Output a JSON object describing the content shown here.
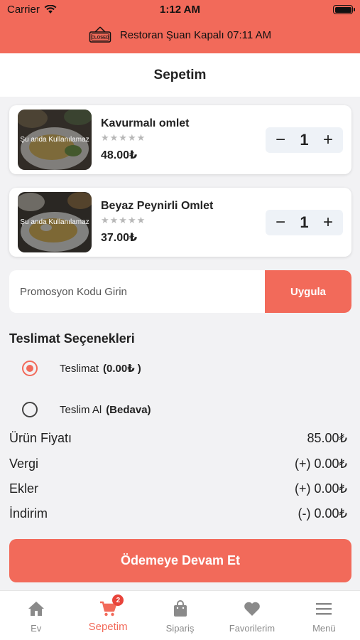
{
  "status_bar": {
    "carrier": "Carrier",
    "time": "1:12 AM"
  },
  "banner": {
    "sign_text": "CLOSED",
    "text": "Restoran Şuan Kapalı 07:11 AM"
  },
  "header": {
    "title": "Sepetim"
  },
  "cart": {
    "items": [
      {
        "name": "Kavurmalı omlet",
        "unavailable_label": "Şu anda Kullanılamaz",
        "rating": 0,
        "stars": "★★★★★",
        "price": "48.00₺",
        "quantity": "1"
      },
      {
        "name": "Beyaz Peynirli Omlet",
        "unavailable_label": "Şu anda Kullanılamaz",
        "rating": 0,
        "stars": "★★★★★",
        "price": "37.00₺",
        "quantity": "1"
      }
    ],
    "minus_symbol": "−",
    "plus_symbol": "+"
  },
  "promo": {
    "placeholder": "Promosyon Kodu Girin",
    "button_label": "Uygula"
  },
  "delivery": {
    "title": "Teslimat Seçenekleri",
    "options": [
      {
        "label": "Teslimat",
        "note": "(0.00₺ )",
        "selected": true
      },
      {
        "label": "Teslim Al",
        "note": "(Bedava)",
        "selected": false
      }
    ]
  },
  "summary": {
    "rows": [
      {
        "label": "Ürün Fiyatı",
        "value": "85.00₺"
      },
      {
        "label": "Vergi",
        "value": "(+) 0.00₺"
      },
      {
        "label": "Ekler",
        "value": "(+) 0.00₺"
      },
      {
        "label": "İndirim",
        "value": "(-) 0.00₺"
      }
    ]
  },
  "checkout": {
    "label": "Ödemeye Devam Et"
  },
  "tabbar": {
    "tabs": [
      {
        "label": "Ev",
        "icon": "home-icon"
      },
      {
        "label": "Sepetim",
        "icon": "cart-icon",
        "active": true,
        "badge": "2"
      },
      {
        "label": "Sipariş",
        "icon": "bag-icon"
      },
      {
        "label": "Favorilerim",
        "icon": "heart-icon"
      },
      {
        "label": "Menü",
        "icon": "menu-icon"
      }
    ]
  },
  "colors": {
    "accent": "#f26a5a",
    "badge": "#e8433a",
    "background": "#f2f2f4"
  }
}
